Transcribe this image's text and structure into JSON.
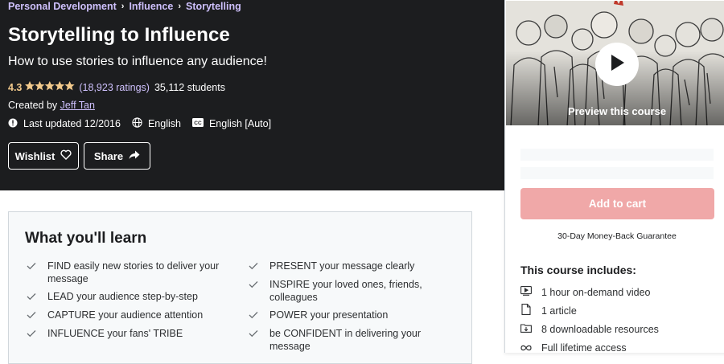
{
  "breadcrumb": {
    "items": [
      {
        "label": "Personal Development"
      },
      {
        "label": "Influence"
      },
      {
        "label": "Storytelling"
      }
    ],
    "separator": "›"
  },
  "course": {
    "title": "Storytelling to Influence",
    "subtitle": "How to use stories to influence any audience!",
    "rating_value": "4.3",
    "stars": "★★★★★",
    "star_fill_fraction": 0.86,
    "ratings_count": "(18,923 ratings)",
    "students": "35,112 students",
    "created_prefix": "Created by",
    "instructor": "Jeff Tan",
    "last_updated": "Last updated 12/2016",
    "language": "English",
    "captions": "English [Auto]"
  },
  "actions": {
    "wishlist_label": "Wishlist",
    "share_label": "Share"
  },
  "sidebar": {
    "preview_label": "Preview this course",
    "add_to_cart_label": "Add to cart",
    "guarantee": "30-Day Money-Back Guarantee",
    "includes_title": "This course includes:",
    "includes": [
      {
        "icon": "video-icon",
        "label": "1 hour on-demand video"
      },
      {
        "icon": "file-icon",
        "label": "1 article"
      },
      {
        "icon": "download-icon",
        "label": "8 downloadable resources"
      },
      {
        "icon": "infinity-icon",
        "label": "Full lifetime access"
      }
    ]
  },
  "learn": {
    "title": "What you'll learn",
    "left": [
      "FIND easily new stories to deliver your message",
      "LEAD your audience step-by-step",
      "CAPTURE your audience attention",
      "INFLUENCE your fans' TRIBE"
    ],
    "right": [
      "PRESENT your message clearly",
      "INSPIRE your loved ones, friends, colleagues",
      "POWER your presentation",
      "be CONFIDENT in delivering your message"
    ]
  },
  "colors": {
    "hero_bg": "#1c1d1f",
    "link_purple": "#cec0fc",
    "star_gold": "#f3ca8c",
    "cart_pink": "#f0a8a8"
  }
}
